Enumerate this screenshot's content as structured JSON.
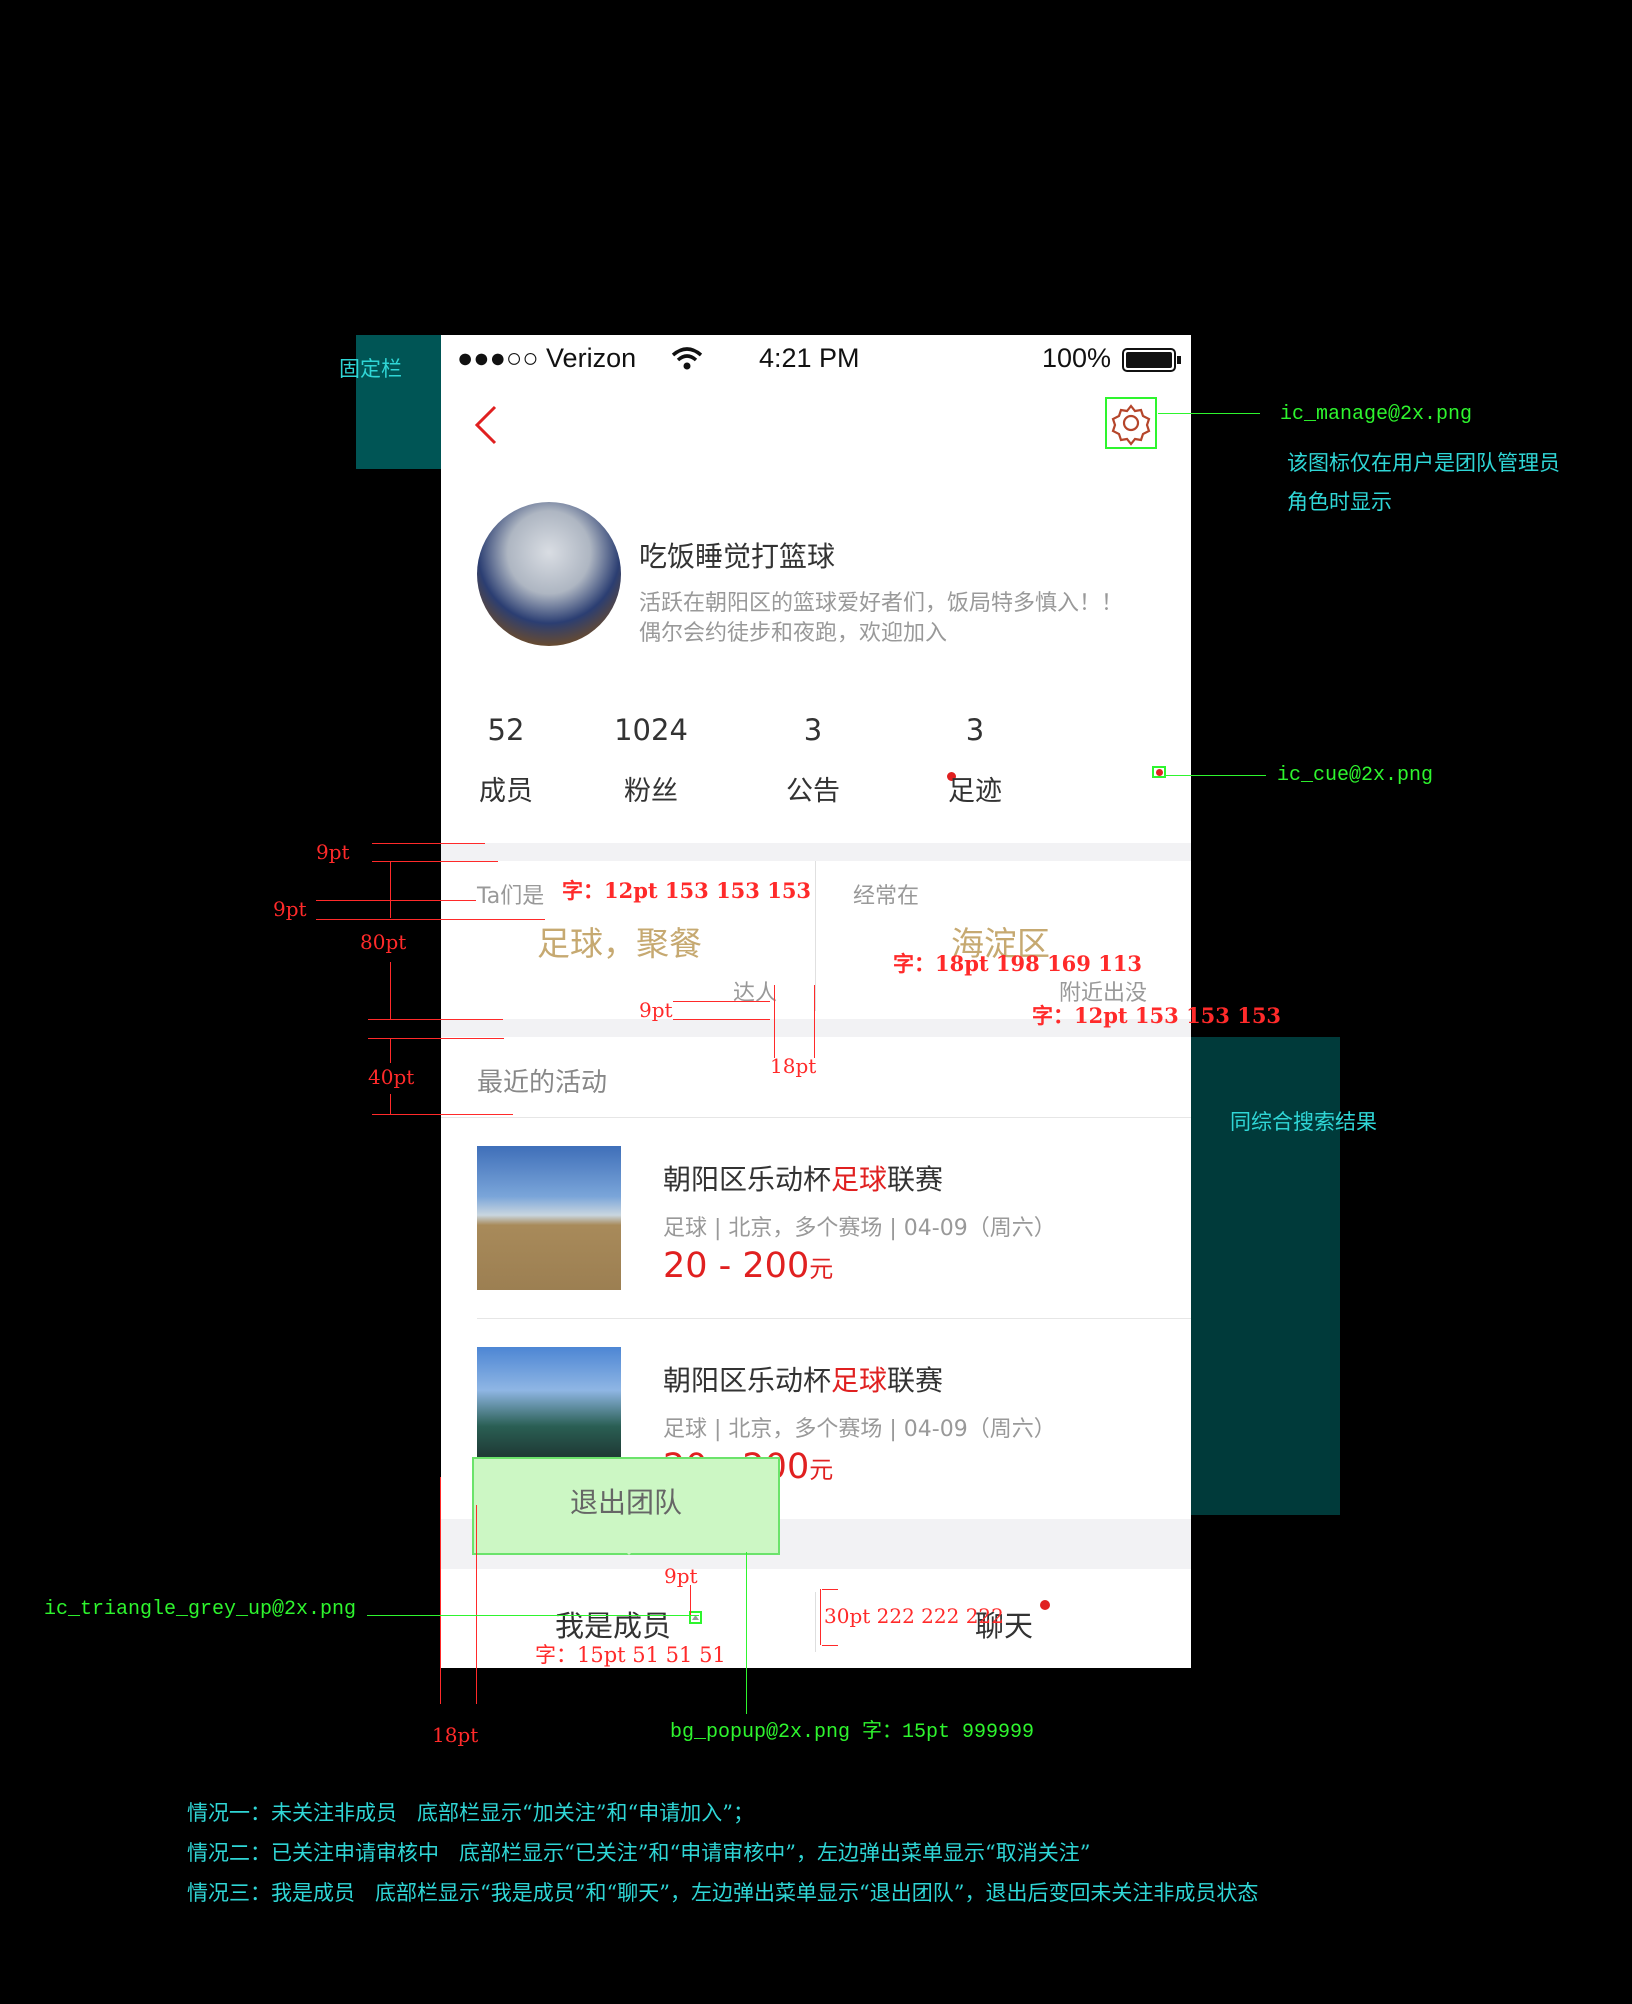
{
  "annotations": {
    "fixed_bar": "固定栏",
    "manage_icon_file": "ic_manage@2x.png",
    "manage_icon_note_1": "该图标仅在用户是团队管理员",
    "manage_icon_note_2": "角色时显示",
    "cue_icon_file": "ic_cue@2x.png",
    "same_as_search": "同综合搜索结果",
    "triangle_file": "ic_triangle_grey_up@2x.png",
    "popup_bg": "bg_popup@2x.png 字：15pt 999999",
    "spec_9pt_a": "9pt",
    "spec_9pt_b": "9pt",
    "spec_80pt": "80pt",
    "spec_40pt": "40pt",
    "spec_9pt_c": "9pt",
    "spec_18pt_a": "18pt",
    "spec_9pt_d": "9pt",
    "spec_18pt_b": "18pt",
    "spec_text_12pt": "字：12pt 153 153 153",
    "spec_text_18pt": "字：18pt 198 169 113",
    "spec_text_12pt_b": "字：12pt 153 153 153",
    "spec_text_15pt": "字：15pt 51 51 51",
    "spec_30pt": "30pt 222 222 222",
    "case1": "情况一：未关注非成员   底部栏显示“加关注”和“申请加入”；",
    "case2": "情况二：已关注申请审核中   底部栏显示“已关注”和“申请审核中”，左边弹出菜单显示“取消关注”",
    "case3": "情况三：我是成员   底部栏显示“我是成员”和“聊天”，左边弹出菜单显示“退出团队”，退出后变回未关注非成员状态"
  },
  "status_bar": {
    "carrier": "●●●○○ Verizon",
    "time": "4:21 PM",
    "battery": "100%"
  },
  "team": {
    "name": "吃饭睡觉打篮球",
    "desc_line1": "活跃在朝阳区的篮球爱好者们，饭局特多慎入！！",
    "desc_line2": "偶尔会约徒步和夜跑，欢迎加入"
  },
  "stats": [
    {
      "value": "52",
      "label": "成员"
    },
    {
      "value": "1024",
      "label": "粉丝"
    },
    {
      "value": "3",
      "label": "公告"
    },
    {
      "value": "3",
      "label": "足迹"
    }
  ],
  "tags": {
    "left_prefix": "Ta们是",
    "left_value": "足球，聚餐",
    "left_suffix": "达人",
    "right_prefix": "经常在",
    "right_value": "海淀区",
    "right_suffix": "附近出没"
  },
  "recent": {
    "title": "最近的活动",
    "items": [
      {
        "title_a": "朝阳区乐动杯",
        "title_hl": "足球",
        "title_b": "联赛",
        "meta": "足球 | 北京，多个赛场 | 04-09（周六）",
        "price": "20 - 200",
        "unit": "元"
      },
      {
        "title_a": "朝阳区乐动杯",
        "title_hl": "足球",
        "title_b": "联赛",
        "meta": "足球 | 北京，多个赛场 | 04-09（周六）",
        "price": "20 - 200",
        "unit": "元"
      }
    ]
  },
  "popup": {
    "label": "退出团队"
  },
  "bottom_bar": {
    "left": "我是成员",
    "right": "聊天"
  },
  "colors": {
    "accent": "#e02020",
    "tan": "#c6a971",
    "grey": "#999999",
    "teal_block": "#004d4d"
  }
}
